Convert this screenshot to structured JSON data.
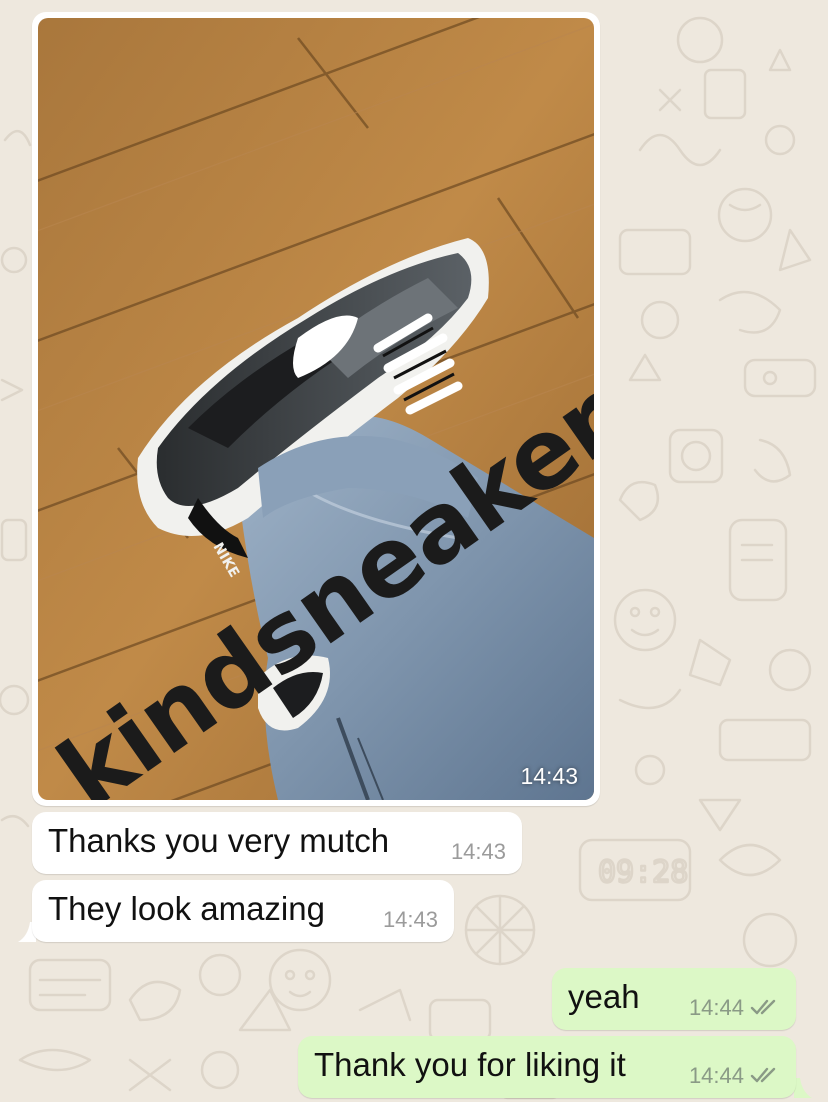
{
  "photo_message": {
    "time": "14:43",
    "watermark": "kindsneaker",
    "image_description_icon": "sneaker-photo"
  },
  "messages": [
    {
      "direction": "incoming",
      "text": "Thanks you very mutch",
      "time": "14:43"
    },
    {
      "direction": "incoming",
      "text": "They look amazing",
      "time": "14:43"
    },
    {
      "direction": "outgoing",
      "text": "yeah",
      "time": "14:44",
      "status": "read"
    },
    {
      "direction": "outgoing",
      "text": "Thank you for liking it",
      "time": "14:44",
      "status": "read"
    }
  ],
  "background_clock": "09:28",
  "colors": {
    "incoming_bubble": "#ffffff",
    "outgoing_bubble": "#dcf8c6",
    "chat_background": "#eee8de"
  }
}
